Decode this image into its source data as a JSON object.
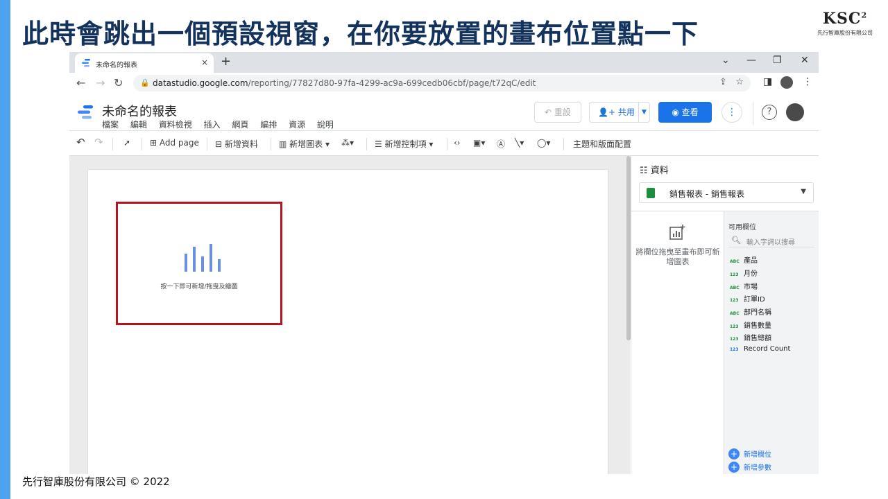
{
  "slide": {
    "title": "此時會跳出一個預設視窗，在你要放置的畫布位置點一下",
    "logo_mark": "KSC",
    "logo_sup": "2",
    "logo_sub": "先行智庫股份有限公司",
    "footer": "先行智庫股份有限公司 © 2022",
    "accent_color": "#4da3f0",
    "title_color": "#13325c"
  },
  "browser": {
    "tab_title": "未命名的報表",
    "tab_close": "×",
    "new_tab": "+",
    "url_domain": "datastudio.google.com",
    "url_path": "/reporting/77827d80-97fa-4299-ac9a-699cedb06cbf/page/t72qC/edit",
    "win_controls": [
      "⌄",
      "—",
      "❐",
      "✕"
    ]
  },
  "app": {
    "report_title": "未命名的報表",
    "menu": [
      "檔案",
      "編輯",
      "資料檢視",
      "插入",
      "網頁",
      "編排",
      "資源",
      "說明"
    ],
    "reset_label": "重設",
    "share_label": "共用",
    "view_label": "查看",
    "help_glyph": "?"
  },
  "toolbar": {
    "add_page": "Add page",
    "add_data": "新增資料",
    "add_chart": "新增圖表",
    "add_control": "新增控制項",
    "theme_layout": "主題和版面配置"
  },
  "canvas": {
    "placeholder_text": "按一下即可新增/拖曳及繪圖",
    "highlight_color": "#b3141d"
  },
  "panel": {
    "title": "資料",
    "datasource": "銷售報表 - 銷售報表",
    "drop_hint": "將欄位拖曳至畫布即可新增圖表",
    "fields_title": "可用欄位",
    "search_placeholder": "輸入字詞以搜尋",
    "fields": [
      {
        "type": "ABC",
        "kind": "dim",
        "label": "產品"
      },
      {
        "type": "123",
        "kind": "dim",
        "label": "月份"
      },
      {
        "type": "ABC",
        "kind": "dim",
        "label": "市場"
      },
      {
        "type": "123",
        "kind": "dim",
        "label": "訂單ID"
      },
      {
        "type": "ABC",
        "kind": "dim",
        "label": "部門名稱"
      },
      {
        "type": "123",
        "kind": "dim",
        "label": "銷售數量"
      },
      {
        "type": "123",
        "kind": "dim",
        "label": "銷售總額"
      },
      {
        "type": "123",
        "kind": "met",
        "label": "Record Count"
      }
    ],
    "add_field": "新增欄位",
    "add_param": "新增參數"
  }
}
